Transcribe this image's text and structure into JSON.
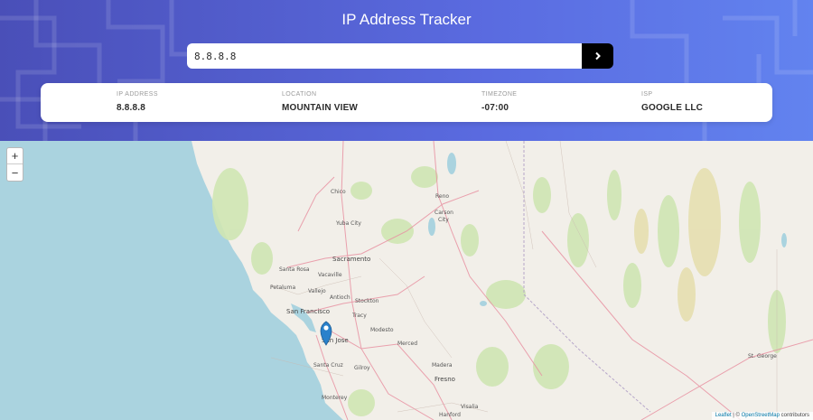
{
  "header": {
    "title": "IP Address Tracker"
  },
  "search": {
    "value": "8.8.8.8",
    "button_icon": "chevron-right-icon"
  },
  "info": {
    "ip_label": "IP ADDRESS",
    "ip_value": "8.8.8.8",
    "location_label": "LOCATION",
    "location_value": "MOUNTAIN VIEW",
    "timezone_label": "TIMEZONE",
    "timezone_value": "-07:00",
    "isp_label": "ISP",
    "isp_value": "GOOGLE LLC"
  },
  "map": {
    "zoom_in": "+",
    "zoom_out": "−",
    "attribution_leaflet": "Leaflet",
    "attribution_sep": " | © ",
    "attribution_osm": "OpenStreetMap",
    "attribution_tail": " contributors",
    "marker_icon": "map-marker-icon",
    "cities": {
      "chico": "Chico",
      "reno": "Reno",
      "carson": "Carson",
      "carson2": "City",
      "yuba": "Yuba City",
      "sacramento": "Sacramento",
      "santa_rosa": "Santa Rosa",
      "vacaville": "Vacaville",
      "petaluma": "Petaluma",
      "vallejo": "Vallejo",
      "antioch": "Antioch",
      "stockton": "Stockton",
      "tracy": "Tracy",
      "sanfrancisco": "San Francisco",
      "modesto": "Modesto",
      "sanjose": "San Jose",
      "merced": "Merced",
      "santacruz": "Santa Cruz",
      "gilroy": "Gilroy",
      "madera": "Madera",
      "fresno": "Fresno",
      "monterey": "Monterey",
      "visalia": "Visalia",
      "hanford": "Hanford",
      "stgeorge": "St. George"
    }
  },
  "colors": {
    "accent_start": "#4a4fb8",
    "accent_end": "#6283ef",
    "water": "#aad3df",
    "land": "#f2efe9",
    "marker": "#2a81cb"
  }
}
